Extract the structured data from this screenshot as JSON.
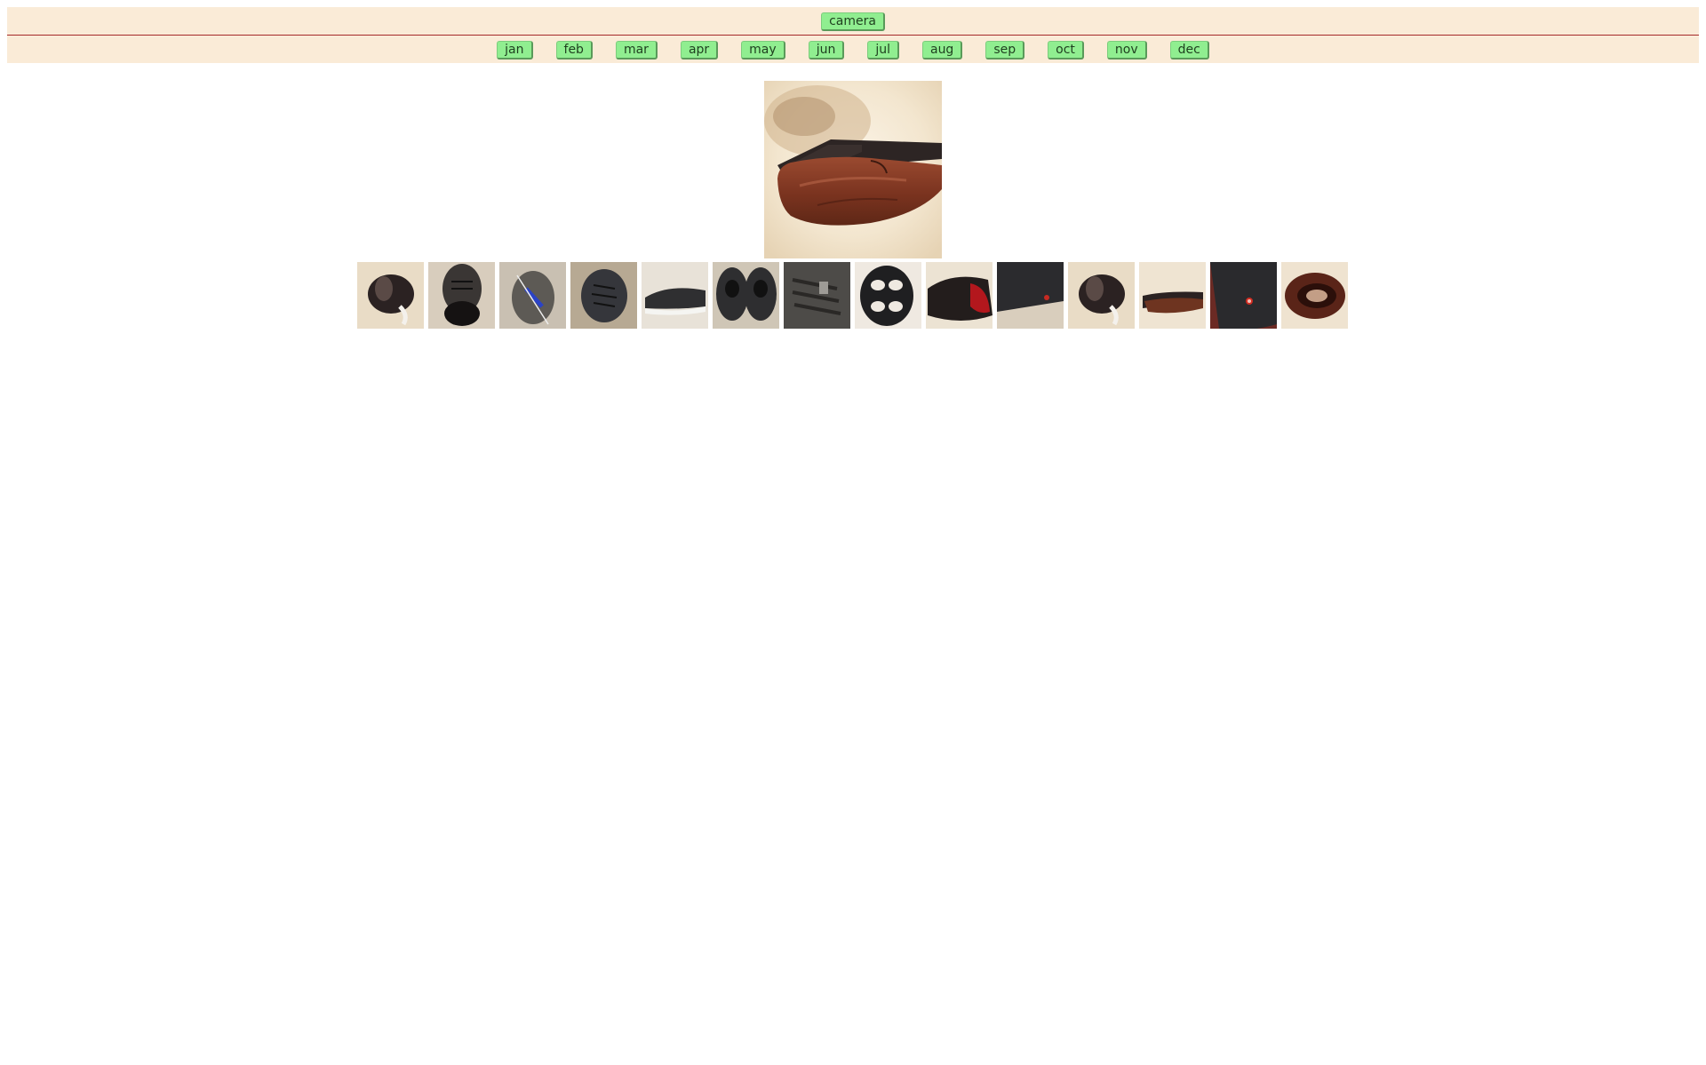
{
  "nav": {
    "camera_label": "camera",
    "months": [
      "jan",
      "feb",
      "mar",
      "apr",
      "may",
      "jun",
      "jul",
      "aug",
      "sep",
      "oct",
      "nov",
      "dec"
    ]
  },
  "main_photo": {
    "subject": "brown leather shoe, side view"
  },
  "thumbnails": [
    {
      "subject": "dark sandal, top view",
      "bg": "#e9dcc6",
      "fg": "#2b2222"
    },
    {
      "subject": "grey knit sneaker, heel view",
      "bg": "#d8cdbd",
      "fg": "#3a3634"
    },
    {
      "subject": "grey sneaker with blue label",
      "bg": "#c9c0b2",
      "fg": "#5d5a55"
    },
    {
      "subject": "dark knit sneaker, top view",
      "bg": "#b7a993",
      "fg": "#35363b"
    },
    {
      "subject": "black sneaker, side view",
      "bg": "#e8e2d8",
      "fg": "#2f2f31"
    },
    {
      "subject": "pair of dark sneakers",
      "bg": "#cfc6b6",
      "fg": "#2e2e30"
    },
    {
      "subject": "grey knit sneaker, close up",
      "bg": "#8f8a83",
      "fg": "#4d4b48"
    },
    {
      "subject": "black sole tread",
      "bg": "#efe9e1",
      "fg": "#1f1f21"
    },
    {
      "subject": "black shoe with red lining",
      "bg": "#ece3d3",
      "fg": "#231d1c"
    },
    {
      "subject": "black shoe sole with red dot",
      "bg": "#d9cebd",
      "fg": "#2b2b2e"
    },
    {
      "subject": "dark sandal, top view",
      "bg": "#e9dcc6",
      "fg": "#2b2222"
    },
    {
      "subject": "brown leather shoe, side view",
      "bg": "#efe4d2",
      "fg": "#6e3420"
    },
    {
      "subject": "black sole with red dot",
      "bg": "#6b2a24",
      "fg": "#2a2a2d"
    },
    {
      "subject": "brown leather shoe, top view",
      "bg": "#efe3d0",
      "fg": "#5a2418"
    }
  ]
}
